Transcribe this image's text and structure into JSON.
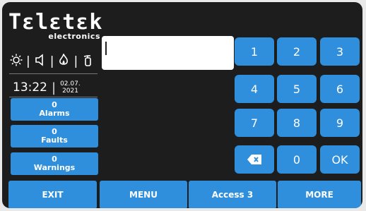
{
  "logo": {
    "brand": "Tεlεtεk",
    "sub": "electronics"
  },
  "status_icons": [
    "sun-icon",
    "speaker-icon",
    "fire-icon",
    "extinguisher-icon"
  ],
  "datetime": {
    "time": "13:22",
    "date_line1": "02.07.",
    "date_line2": "2021"
  },
  "status_buttons": [
    {
      "count": "0",
      "label": "Alarms"
    },
    {
      "count": "0",
      "label": "Faults"
    },
    {
      "count": "0",
      "label": "Warnings"
    }
  ],
  "entry": {
    "value": ""
  },
  "keypad": {
    "k1": "1",
    "k2": "2",
    "k3": "3",
    "k4": "4",
    "k5": "5",
    "k6": "6",
    "k7": "7",
    "k8": "8",
    "k9": "9",
    "k0": "0",
    "ok": "OK"
  },
  "bottom": {
    "exit": "EXIT",
    "menu": "MENU",
    "access": "Access 3",
    "more": "MORE"
  },
  "colors": {
    "background": "#1d1d1d",
    "button": "#2f8fdc",
    "text": "#ffffff"
  }
}
